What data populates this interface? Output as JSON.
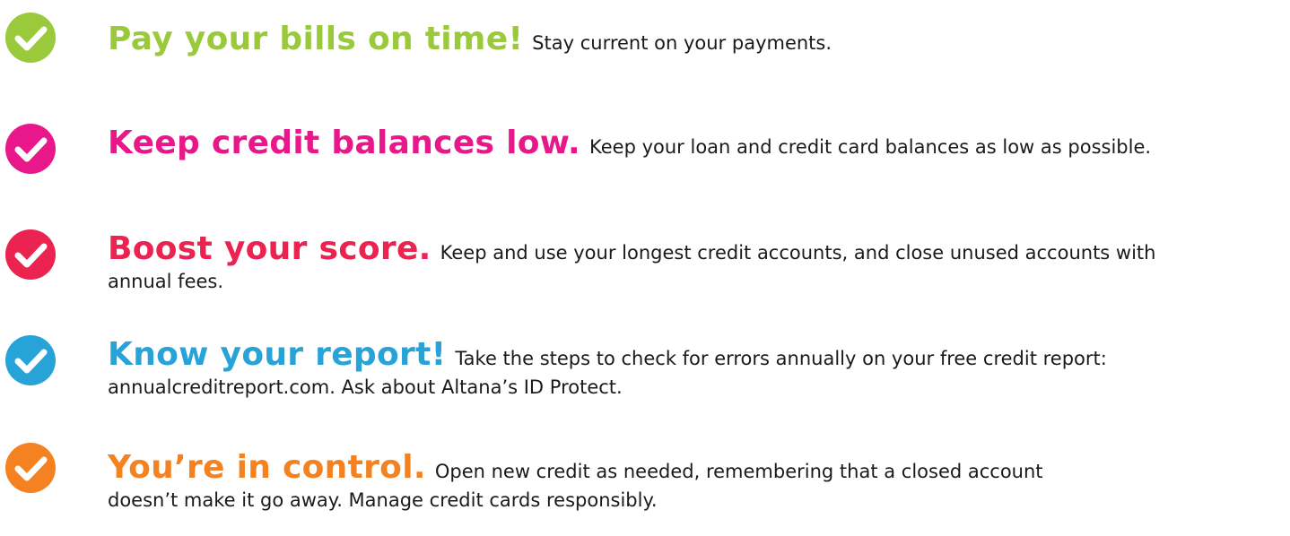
{
  "colors": {
    "green": "#9ACA3C",
    "magenta": "#E8178A",
    "red": "#EA2350",
    "blue": "#27A3D8",
    "orange": "#F58220",
    "body_text": "#1a1a1a"
  },
  "icons": {
    "badge": "check-circle-icon"
  },
  "tips": [
    {
      "heading": "Pay your bills on time!",
      "body": "Stay current on your payments."
    },
    {
      "heading": "Keep credit balances low.",
      "body": "Keep your loan and credit card balances as low as possible."
    },
    {
      "heading": "Boost your score.",
      "body": "Keep and use your longest credit accounts, and close unused accounts with annual fees."
    },
    {
      "heading": "Know your report!",
      "body": "Take the steps to check for errors annually on your free credit report: annualcreditreport.com. Ask about Altana’s ID Protect."
    },
    {
      "heading": "You’re in control.",
      "body": "Open new credit as needed, remembering that a closed account doesn’t make it go away. Manage credit cards responsibly."
    }
  ]
}
